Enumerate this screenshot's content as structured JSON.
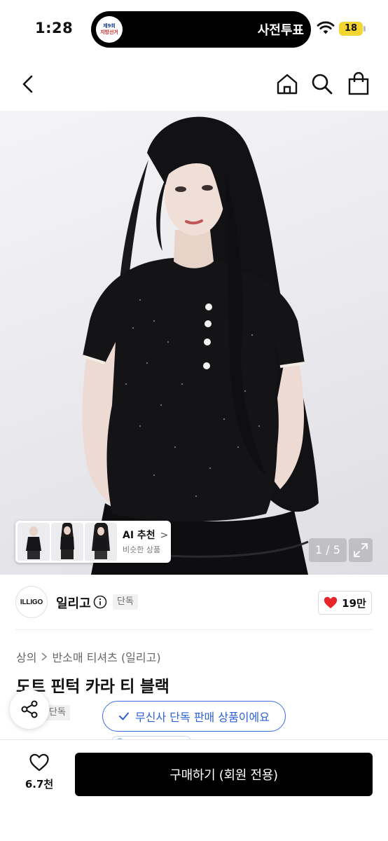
{
  "status_bar": {
    "time": "1:28",
    "live_activity_text": "사전투표",
    "election_badge": {
      "line1": "제9회",
      "line2": "지방선거"
    },
    "battery_level": "18",
    "battery_color": "#f2d530"
  },
  "nav": {
    "icons": [
      "back-arrow-icon",
      "home-icon",
      "search-icon",
      "shopping-bag-icon"
    ]
  },
  "gallery": {
    "current_page": "1",
    "total_pages": "5",
    "page_counter": "1 / 5",
    "ai_recommend": {
      "title": "AI 추천",
      "subtitle": "비슷한 상품",
      "thumbnail_count": 3
    }
  },
  "brand": {
    "logo_text": "ILLIGO",
    "name": "일리고",
    "exclusive_tag": "단독",
    "likes": "19만",
    "like_color": "#e8262a"
  },
  "product": {
    "breadcrumb": [
      "상의",
      "반소매 티셔츠 (일리고)"
    ],
    "title": "도트 핀턱 카라 티 블랙",
    "exclusive_tag": "단독",
    "exclusive_notice": "무신사 단독 판매 상품이에요",
    "notice_color": "#2f61d6"
  },
  "bottom_bar": {
    "wish_count": "6.7천",
    "buy_label": "구매하기 (회원 전용)"
  }
}
